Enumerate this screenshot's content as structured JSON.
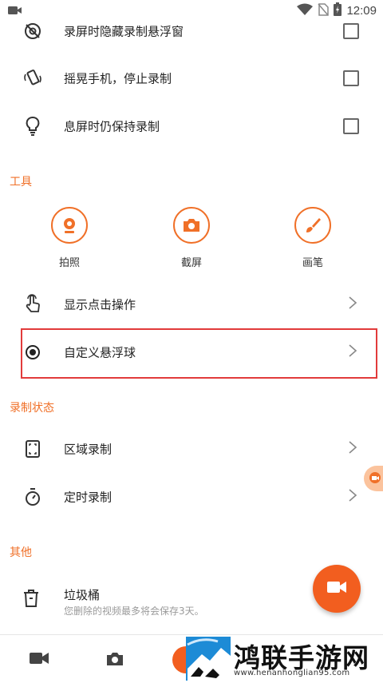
{
  "status_bar": {
    "time": "12:09"
  },
  "settings_top": [
    {
      "label": "录屏时隐藏录制悬浮窗",
      "icon": "eye-off-icon",
      "checked": false
    },
    {
      "label": "摇晃手机，停止录制",
      "icon": "shake-phone-icon",
      "checked": false
    },
    {
      "label": "息屏时仍保持录制",
      "icon": "lightbulb-icon",
      "checked": false
    }
  ],
  "tools_section": {
    "title": "工具",
    "items": [
      {
        "label": "拍照",
        "icon": "webcam-icon"
      },
      {
        "label": "截屏",
        "icon": "camera-icon"
      },
      {
        "label": "画笔",
        "icon": "brush-icon"
      }
    ]
  },
  "nav_rows": [
    {
      "label": "显示点击操作",
      "icon": "tap-hand-icon"
    },
    {
      "label": "自定义悬浮球",
      "icon": "radio-dot-icon"
    }
  ],
  "record_status_section": {
    "title": "录制状态",
    "items": [
      {
        "label": "区域录制",
        "icon": "area-select-icon"
      },
      {
        "label": "定时录制",
        "icon": "timer-icon"
      }
    ]
  },
  "other_section": {
    "title": "其他",
    "trash": {
      "label": "垃圾桶",
      "sublabel": "您删除的视频最多将会保存3天。",
      "icon": "trash-icon"
    }
  },
  "watermark": {
    "text": "鸿联手游网",
    "url": "www.henanhonglian95.com"
  },
  "colors": {
    "accent": "#f07028",
    "fab": "#f25e1f",
    "highlight": "#e23b3b"
  }
}
